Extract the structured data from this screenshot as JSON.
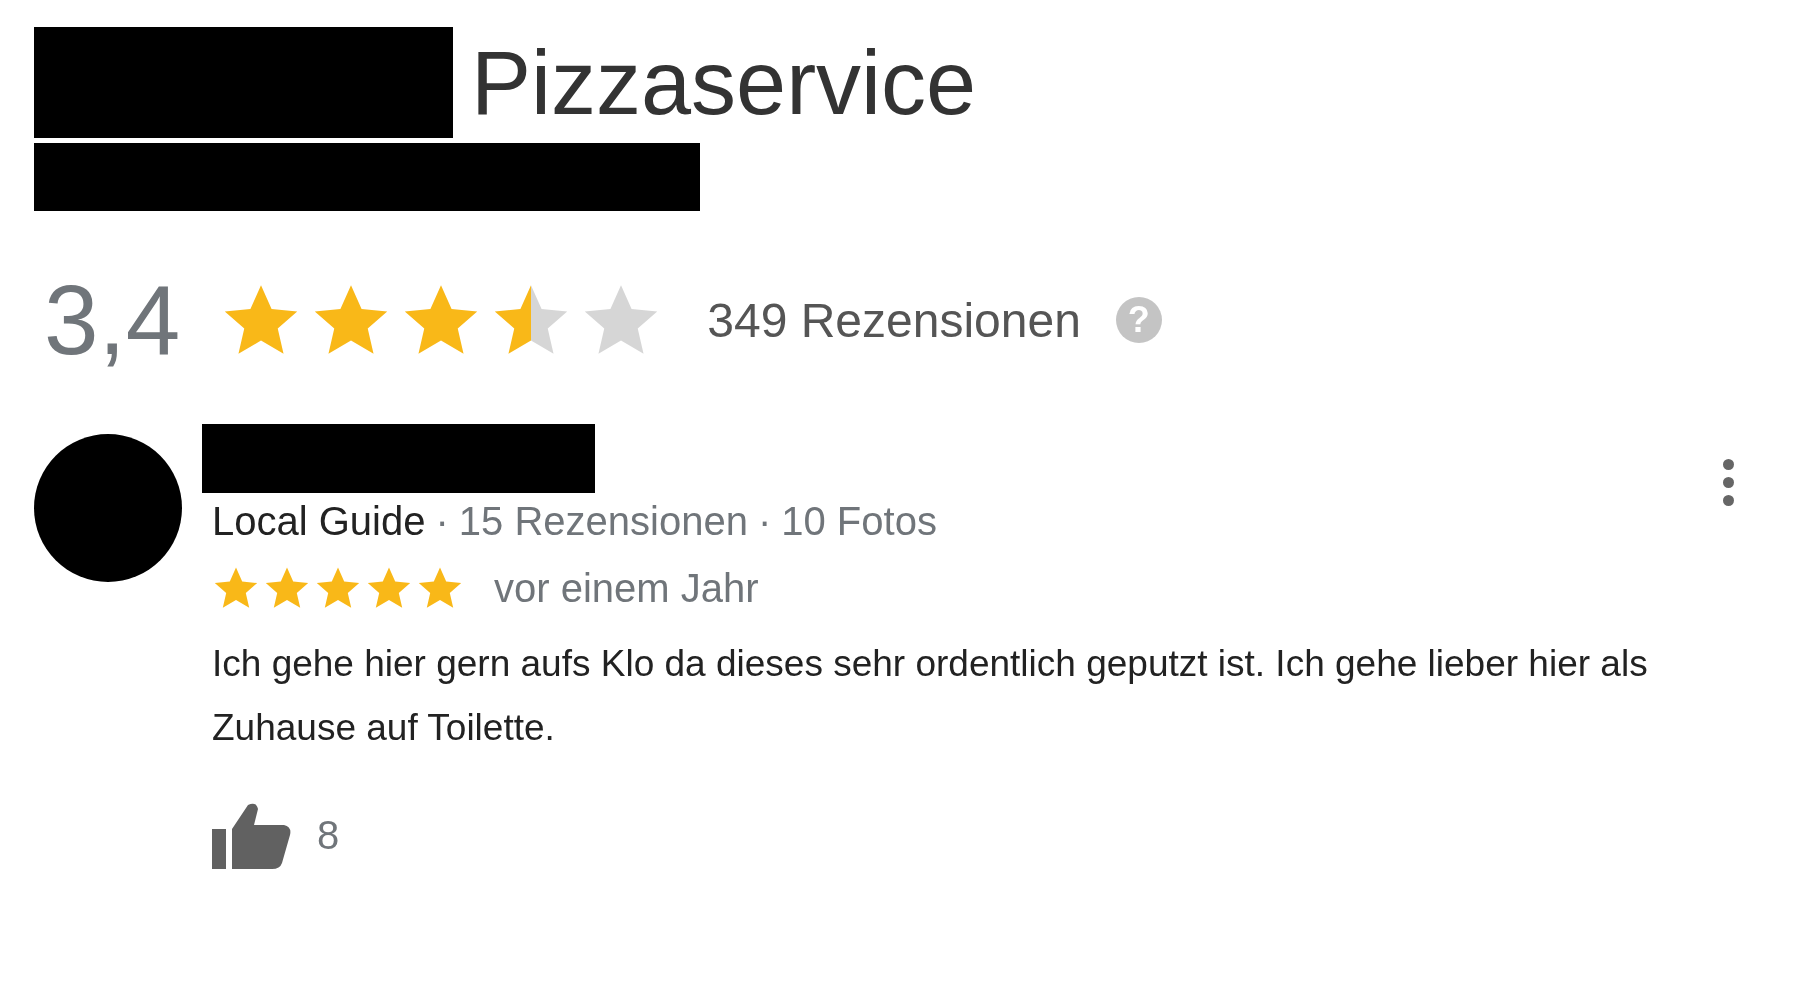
{
  "business": {
    "name": "Pizzaservice"
  },
  "rating": {
    "value": "3,4",
    "stars": 3.5,
    "review_count": "349 Rezensionen",
    "help": "?"
  },
  "review": {
    "meta": [
      "Local Guide",
      "15 Rezensionen",
      "10 Fotos"
    ],
    "separator": "·",
    "stars": 5,
    "time": "vor einem Jahr",
    "text": "Ich gehe hier gern aufs Klo da dieses sehr ordentlich geputzt ist. Ich gehe lieber hier als Zuhause auf Toilette.",
    "likes": "8"
  }
}
